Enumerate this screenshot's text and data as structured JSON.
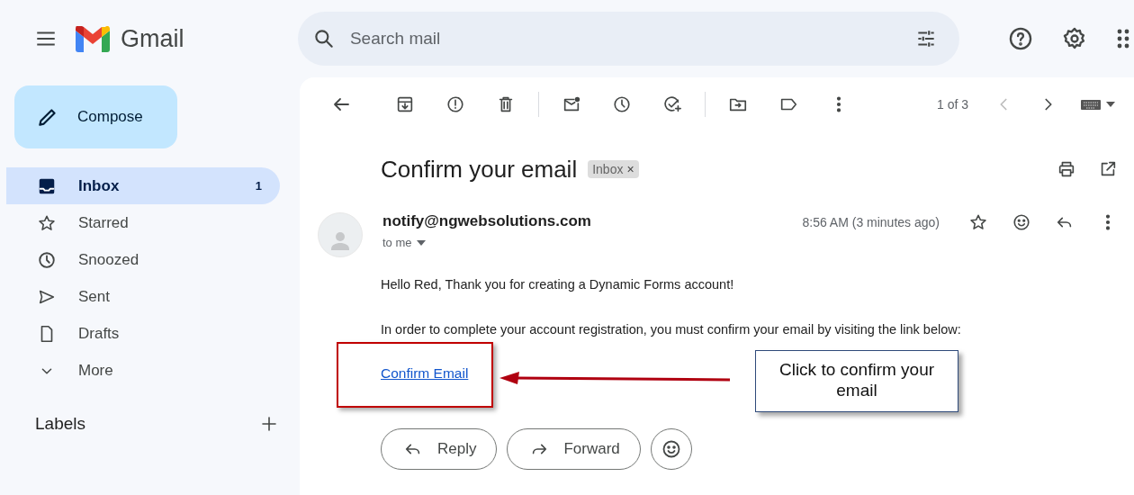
{
  "app": {
    "name": "Gmail"
  },
  "search": {
    "placeholder": "Search mail"
  },
  "compose": {
    "label": "Compose"
  },
  "sidebar": {
    "items": [
      {
        "label": "Inbox",
        "count": "1",
        "selected": true
      },
      {
        "label": "Starred",
        "selected": false
      },
      {
        "label": "Snoozed",
        "selected": false
      },
      {
        "label": "Sent",
        "selected": false
      },
      {
        "label": "Drafts",
        "selected": false
      },
      {
        "label": "More",
        "selected": false
      }
    ],
    "labels_heading": "Labels"
  },
  "toolbar": {
    "pager": "1 of 3"
  },
  "message": {
    "subject": "Confirm your email",
    "label_chip": "Inbox",
    "chip_close": "×",
    "sender": "notify@ngwebsolutions.com",
    "recipient": "to me",
    "time": "8:56 AM (3 minutes ago)",
    "greeting": "Hello Red, Thank you for creating a Dynamic Forms account!",
    "instruction": "In order to complete your account registration, you must confirm your email by visiting the link below:",
    "link": "Confirm Email",
    "buttons": [
      "Reply",
      "Forward"
    ]
  },
  "annotation": {
    "callout": "Click to confirm your email"
  }
}
